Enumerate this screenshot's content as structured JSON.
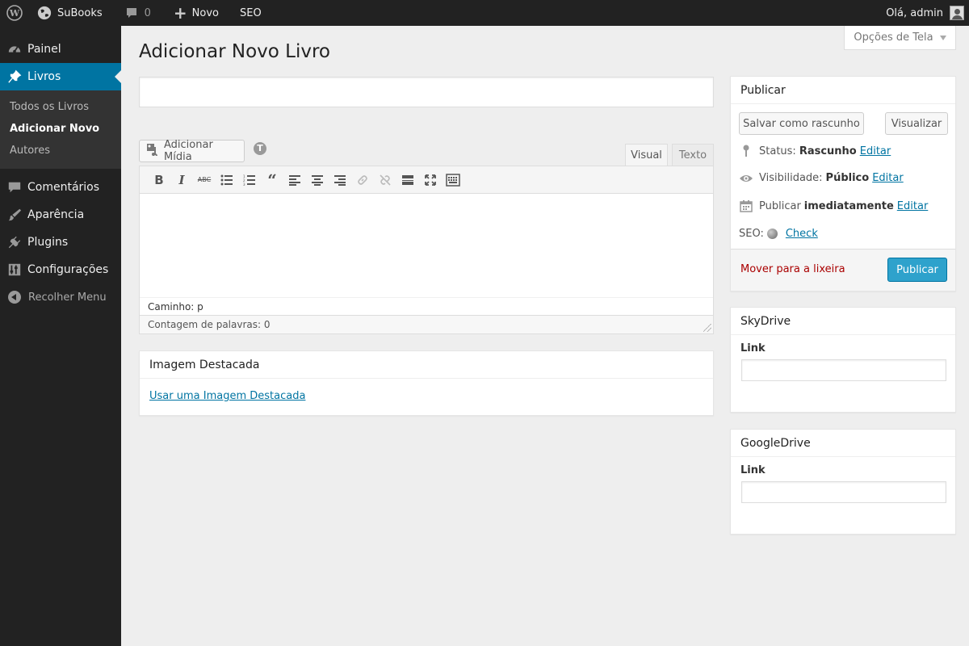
{
  "adminbar": {
    "site_name": "SuBooks",
    "comments_count": "0",
    "new_label": "Novo",
    "seo_label": "SEO",
    "greeting": "Olá, admin"
  },
  "sidebar": {
    "items": [
      {
        "label": "Painel",
        "icon": "dashboard-icon"
      },
      {
        "label": "Livros",
        "icon": "pin-icon",
        "active": true
      },
      {
        "label": "Comentários",
        "icon": "comment-icon"
      },
      {
        "label": "Aparência",
        "icon": "paintbrush-icon"
      },
      {
        "label": "Plugins",
        "icon": "plugin-icon"
      },
      {
        "label": "Configurações",
        "icon": "settings-icon"
      }
    ],
    "submenu": [
      "Todos os Livros",
      "Adicionar Novo",
      "Autores"
    ],
    "collapse_label": "Recolher Menu"
  },
  "screen_options": "Opções de Tela",
  "page_title": "Adicionar Novo Livro",
  "title_input": {
    "value": ""
  },
  "editor": {
    "add_media": "Adicionar Mídia",
    "tab_visual": "Visual",
    "tab_text": "Texto",
    "path": "Caminho: p",
    "word_count": "Contagem de palavras: 0"
  },
  "featured_image": {
    "title": "Imagem Destacada",
    "link": "Usar uma Imagem Destacada"
  },
  "publish": {
    "title": "Publicar",
    "save_draft": "Salvar como rascunho",
    "preview": "Visualizar",
    "status_label": "Status:",
    "status_value": "Rascunho",
    "visibility_label": "Visibilidade:",
    "visibility_value": "Público",
    "schedule_label": "Publicar",
    "schedule_value": "imediatamente",
    "edit": "Editar",
    "seo_label": "SEO:",
    "seo_link": "Check",
    "trash": "Mover para a lixeira",
    "publish_button": "Publicar"
  },
  "skydrive": {
    "title": "SkyDrive",
    "field_label": "Link",
    "value": ""
  },
  "googledrive": {
    "title": "GoogleDrive",
    "field_label": "Link",
    "value": ""
  }
}
